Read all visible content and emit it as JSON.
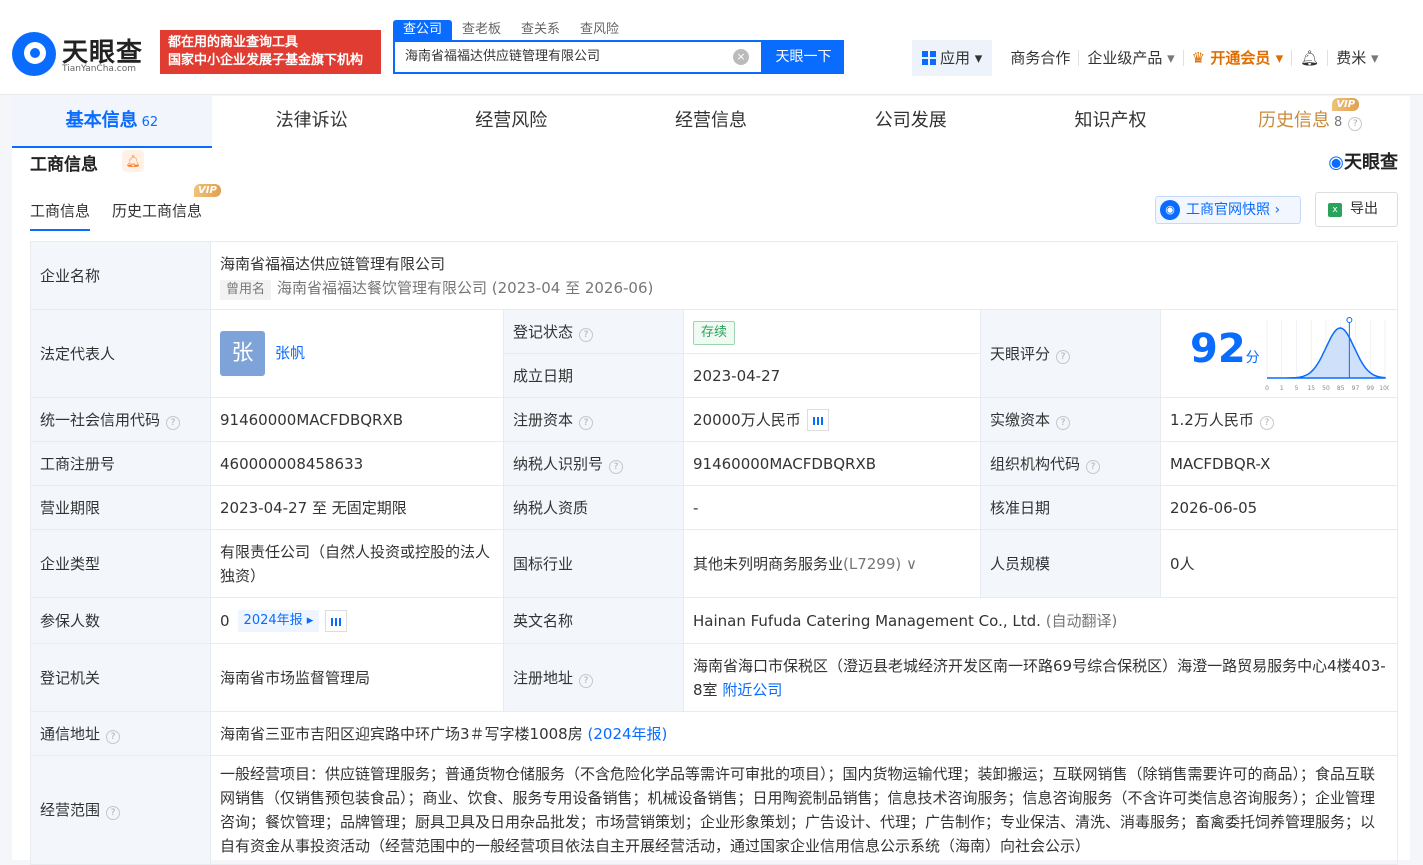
{
  "brand": {
    "name": "天眼查",
    "domain": "TianYanCha.com"
  },
  "slogan": {
    "line1": "都在用的商业查询工具",
    "line2": "国家中小企业发展子基金旗下机构"
  },
  "search": {
    "tabs": [
      "查公司",
      "查老板",
      "查关系",
      "查风险"
    ],
    "active_tab": "查公司",
    "value": "海南省福福达供应链管理有限公司",
    "button": "天眼一下"
  },
  "nav": {
    "app": "应用",
    "items": [
      "商务合作",
      "企业级产品"
    ],
    "vip": "开通会员",
    "user": "费米"
  },
  "tabs": [
    {
      "label": "基本信息",
      "count": "62"
    },
    {
      "label": "法律诉讼"
    },
    {
      "label": "经营风险"
    },
    {
      "label": "经营信息"
    },
    {
      "label": "公司发展"
    },
    {
      "label": "知识产权"
    },
    {
      "label": "历史信息",
      "count": "8"
    }
  ],
  "vip_text": "VIP",
  "section": {
    "title": "工商信息",
    "logo": "天眼查"
  },
  "subtabs": [
    "工商信息",
    "历史工商信息"
  ],
  "buttons": {
    "snapshot": "工商官网快照",
    "export": "导出"
  },
  "info": {
    "company_name_label": "企业名称",
    "company_name": "海南省福福达供应链管理有限公司",
    "former_tag": "曾用名",
    "former_name": "海南省福福达餐饮管理有限公司 (2023-04 至 2026-06)",
    "legal_rep_label": "法定代表人",
    "legal_rep_avatar": "张",
    "legal_rep": "张帆",
    "reg_status_label": "登记状态",
    "reg_status": "存续",
    "est_date_label": "成立日期",
    "est_date": "2023-04-27",
    "score_label": "天眼评分",
    "score": "92",
    "score_unit": "分",
    "credit_code_label": "统一社会信用代码",
    "credit_code": "91460000MACFDBQRXB",
    "reg_capital_label": "注册资本",
    "reg_capital": "20000万人民币",
    "paid_capital_label": "实缴资本",
    "paid_capital": "1.2万人民币",
    "reg_no_label": "工商注册号",
    "reg_no": "460000008458633",
    "taxpayer_id_label": "纳税人识别号",
    "taxpayer_id": "91460000MACFDBQRXB",
    "org_code_label": "组织机构代码",
    "org_code": "MACFDBQR-X",
    "term_label": "营业期限",
    "term": "2023-04-27 至 无固定期限",
    "taxpayer_qual_label": "纳税人资质",
    "taxpayer_qual": "-",
    "approval_date_label": "核准日期",
    "approval_date": "2026-06-05",
    "type_label": "企业类型",
    "type": "有限责任公司（自然人投资或控股的法人独资）",
    "industry_label": "国标行业",
    "industry": "其他未列明商务服务业",
    "industry_code": "(L7299)",
    "staff_label": "人员规模",
    "staff": "0人",
    "insured_label": "参保人数",
    "insured": "0",
    "insured_year": "2024年报",
    "english_label": "英文名称",
    "english": "Hainan Fufuda Catering Management Co., Ltd.",
    "auto_trans": "(自动翻译)",
    "authority_label": "登记机关",
    "authority": "海南省市场监督管理局",
    "address_label": "注册地址",
    "address": "海南省海口市保税区（澄迈县老城经济开发区南一环路69号综合保税区）海澄一路贸易服务中心4楼403-8室",
    "nearby": "附近公司",
    "mail_label": "通信地址",
    "mail": "海南省三亚市吉阳区迎宾路中环广场3＃写字楼1008房",
    "mail_year": "(2024年报)",
    "scope_label": "经营范围",
    "scope": "一般经营项目：供应链管理服务；普通货物仓储服务（不含危险化学品等需许可审批的项目）；国内货物运输代理；装卸搬运；互联网销售（除销售需要许可的商品）；食品互联网销售（仅销售预包装食品）；商业、饮食、服务专用设备销售；机械设备销售；日用陶瓷制品销售；信息技术咨询服务；信息咨询服务（不含许可类信息咨询服务）；企业管理咨询；餐饮管理；品牌管理；厨具卫具及日用杂品批发；市场营销策划；企业形象策划；广告设计、代理；广告制作；专业保洁、清洗、消毒服务；畜禽委托饲养管理服务；以自有资金从事投资活动（经营范围中的一般经营项目依法自主开展经营活动，通过国家企业信用信息公示系统（海南）向社会公示）"
  },
  "chart_data": {
    "type": "area",
    "x": [
      0,
      1,
      5,
      15,
      50,
      85,
      97,
      99,
      100
    ],
    "x_tick_labels": [
      "0",
      "1",
      "5",
      "15",
      "50",
      "85",
      "97",
      "99",
      "100"
    ],
    "marker": 92
  }
}
